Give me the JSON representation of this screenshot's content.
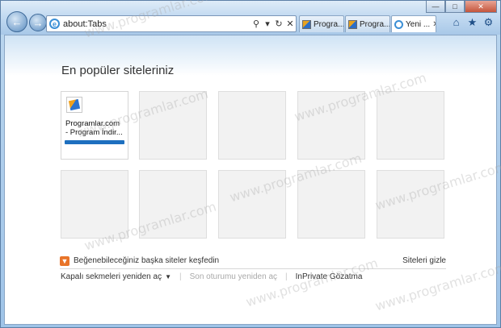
{
  "address": {
    "url": "about:Tabs"
  },
  "tabs": [
    {
      "label": "Progra...",
      "active": false
    },
    {
      "label": "Progra...",
      "active": false
    },
    {
      "label": "Yeni ...",
      "active": true
    }
  ],
  "heading": "En popüler siteleriniz",
  "tiles": [
    {
      "title_line1": "Programlar.com",
      "title_line2": "- Program İndir..."
    }
  ],
  "discover": {
    "label": "Beğenebileceğiniz başka siteler keşfedin",
    "hide_label": "Siteleri gizle"
  },
  "bottom": {
    "reopen_tabs": "Kapalı sekmeleri yeniden aç",
    "reopen_session": "Son oturumu yeniden aç",
    "inprivate": "InPrivate Gözatma"
  },
  "watermark": "www.programlar.com",
  "colors": {
    "accent": "#1d6fbf",
    "discover_icon": "#e8742a"
  },
  "icons": [
    "back-arrow-icon",
    "forward-arrow-icon",
    "ie-icon",
    "search-icon",
    "refresh-icon",
    "stop-icon",
    "home-icon",
    "favorites-star-icon",
    "tools-gear-icon"
  ]
}
